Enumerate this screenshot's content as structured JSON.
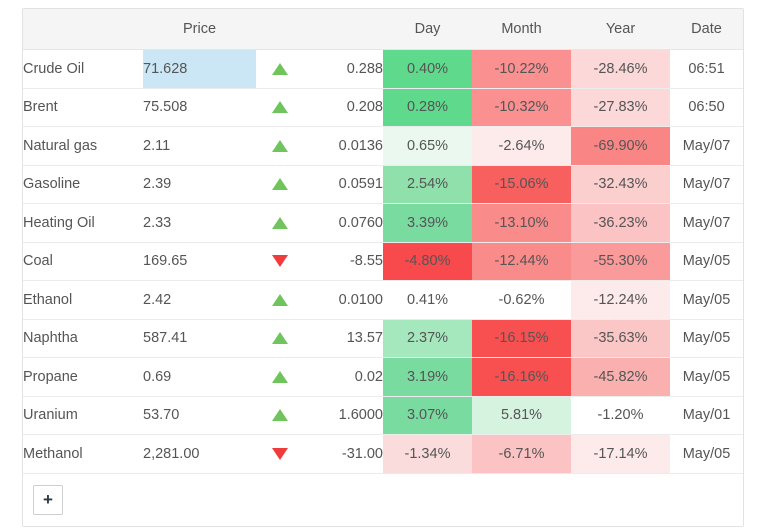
{
  "table": {
    "columns": [
      {
        "key": "name",
        "label": "",
        "align": "left"
      },
      {
        "key": "price",
        "label": "Price",
        "align": "center"
      },
      {
        "key": "arrow",
        "label": "",
        "align": "center"
      },
      {
        "key": "change",
        "label": "",
        "align": "right"
      },
      {
        "key": "day",
        "label": "Day",
        "align": "center"
      },
      {
        "key": "month",
        "label": "Month",
        "align": "center"
      },
      {
        "key": "year",
        "label": "Year",
        "align": "center"
      },
      {
        "key": "date",
        "label": "Date",
        "align": "center"
      }
    ],
    "header": {
      "blank1": "",
      "price": "Price",
      "blank2": "",
      "blank3": "",
      "day": "Day",
      "month": "Month",
      "year": "Year",
      "date": "Date"
    },
    "rows": [
      {
        "name": "Crude Oil",
        "price": "71.628",
        "price_flash": true,
        "direction": "up",
        "change": "0.288",
        "day": "0.40%",
        "day_bg": "#5fd98b",
        "month": "-10.22%",
        "month_bg": "#fa9090",
        "year": "-28.46%",
        "year_bg": "#fcd8d8",
        "date": "06:51"
      },
      {
        "name": "Brent",
        "price": "75.508",
        "price_flash": false,
        "direction": "up",
        "change": "0.208",
        "day": "0.28%",
        "day_bg": "#5fd98b",
        "month": "-10.32%",
        "month_bg": "#fa9090",
        "year": "-27.83%",
        "year_bg": "#fcd8d8",
        "date": "06:50"
      },
      {
        "name": "Natural gas",
        "price": "2.11",
        "price_flash": false,
        "direction": "up",
        "change": "0.0136",
        "day": "0.65%",
        "day_bg": "#eaf8ef",
        "month": "-2.64%",
        "month_bg": "#fdeaea",
        "year": "-69.90%",
        "year_bg": "#fa8585",
        "date": "May/07"
      },
      {
        "name": "Gasoline",
        "price": "2.39",
        "price_flash": false,
        "direction": "up",
        "change": "0.0591",
        "day": "2.54%",
        "day_bg": "#8fe0ab",
        "month": "-15.06%",
        "month_bg": "#f85f5f",
        "year": "-32.43%",
        "year_bg": "#fccfcf",
        "date": "May/07"
      },
      {
        "name": "Heating Oil",
        "price": "2.33",
        "price_flash": false,
        "direction": "up",
        "change": "0.0760",
        "day": "3.39%",
        "day_bg": "#7adba0",
        "month": "-13.10%",
        "month_bg": "#fa8b8b",
        "year": "-36.23%",
        "year_bg": "#fbc3c3",
        "date": "May/07"
      },
      {
        "name": "Coal",
        "price": "169.65",
        "price_flash": false,
        "direction": "down",
        "change": "-8.55",
        "day": "-4.80%",
        "day_bg": "#f84a4d",
        "month": "-12.44%",
        "month_bg": "#fa8b8b",
        "year": "-55.30%",
        "year_bg": "#fa9a9a",
        "date": "May/05"
      },
      {
        "name": "Ethanol",
        "price": "2.42",
        "price_flash": false,
        "direction": "up",
        "change": "0.0100",
        "day": "0.41%",
        "day_bg": "#ffffff",
        "month": "-0.62%",
        "month_bg": "#ffffff",
        "year": "-12.24%",
        "year_bg": "#fdeaea",
        "date": "May/05"
      },
      {
        "name": "Naphtha",
        "price": "587.41",
        "price_flash": false,
        "direction": "up",
        "change": "13.57",
        "day": "2.37%",
        "day_bg": "#a6e8bd",
        "month": "-16.15%",
        "month_bg": "#f85050",
        "year": "-35.63%",
        "year_bg": "#fbc6c6",
        "date": "May/05"
      },
      {
        "name": "Propane",
        "price": "0.69",
        "price_flash": false,
        "direction": "up",
        "change": "0.02",
        "day": "3.19%",
        "day_bg": "#7adba0",
        "month": "-16.16%",
        "month_bg": "#f85050",
        "year": "-45.82%",
        "year_bg": "#fbb0b0",
        "date": "May/05"
      },
      {
        "name": "Uranium",
        "price": "53.70",
        "price_flash": false,
        "direction": "up",
        "change": "1.6000",
        "day": "3.07%",
        "day_bg": "#7adba0",
        "month": "5.81%",
        "month_bg": "#d6f3e0",
        "year": "-1.20%",
        "year_bg": "#ffffff",
        "date": "May/01"
      },
      {
        "name": "Methanol",
        "price": "2,281.00",
        "price_flash": false,
        "direction": "down",
        "change": "-31.00",
        "day": "-1.34%",
        "day_bg": "#fbdcdc",
        "month": "-6.71%",
        "month_bg": "#fbc3c3",
        "year": "-17.14%",
        "year_bg": "#fdeaea",
        "date": "May/05"
      }
    ]
  },
  "footer": {
    "add_label": "+"
  },
  "colors": {
    "flash_highlight": "#cbe7f5",
    "up_arrow": "#6fc45c",
    "down_arrow": "#ef3b3b",
    "up_change_text": "#3c8f3c",
    "header_bg": "#f5f5f5",
    "border": "#e2e2e2"
  }
}
